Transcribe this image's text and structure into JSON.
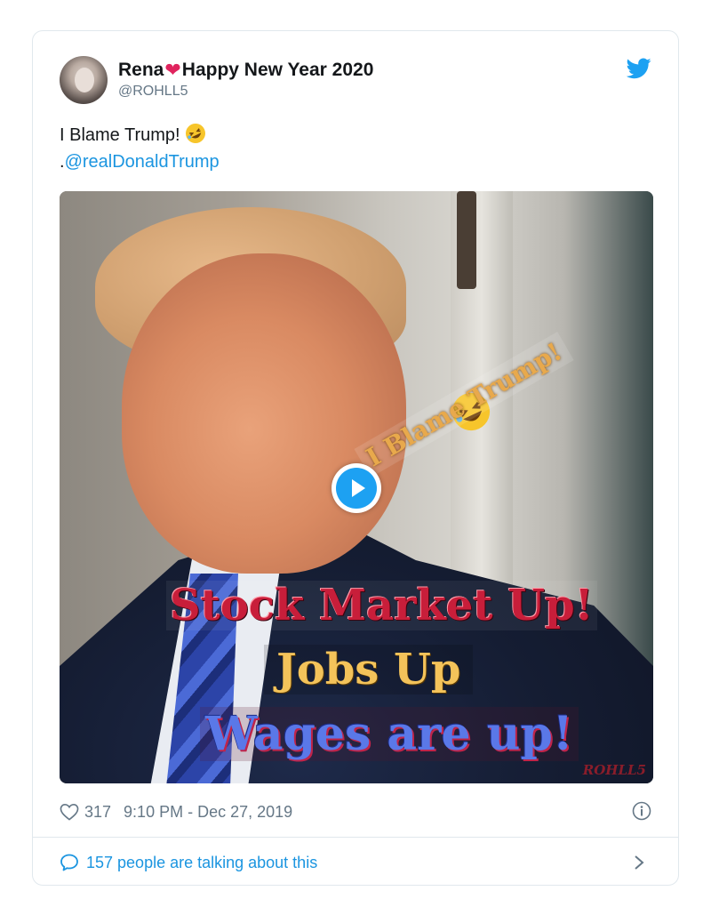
{
  "tweet": {
    "display_name_part1": "Rena",
    "display_name_heart": "❤",
    "display_name_part2": "Happy New Year 2020",
    "handle": "@ROHLL5",
    "text_line1": "I Blame Trump!",
    "text_line2_prefix": ".",
    "mention": "@realDonaldTrump"
  },
  "media": {
    "overlay_blame": "I Blame Trump!",
    "overlay_stock": "Stock Market Up!",
    "overlay_jobs": "Jobs Up",
    "overlay_wages": "Wages are up!",
    "watermark": "ROHLL5"
  },
  "meta": {
    "like_count": "317",
    "timestamp": "9:10 PM - Dec 27, 2019"
  },
  "footer": {
    "talking_text": "157 people are talking about this"
  },
  "icons": {
    "bird": "twitter-bird-icon",
    "like": "heart-outline-icon",
    "info": "info-circle-icon",
    "bubble": "speech-bubble-icon",
    "chevron": "chevron-right-icon",
    "play": "play-icon",
    "emoji": "rofl-emoji-icon"
  },
  "colors": {
    "accent": "#1da1f2",
    "link": "#1b95e0",
    "heart": "#e0245e",
    "secondary_text": "#657786",
    "primary_text": "#14171a",
    "border": "#e1e8ed"
  }
}
